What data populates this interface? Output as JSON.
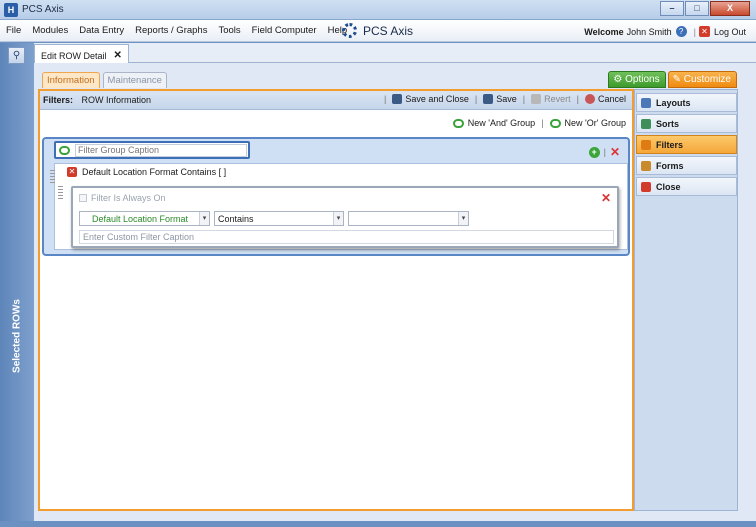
{
  "window": {
    "title": "PCS Axis",
    "controls": [
      "–",
      "□",
      "X"
    ]
  },
  "menubar": {
    "items": [
      "File",
      "Modules",
      "Data Entry",
      "Reports / Graphs",
      "Tools",
      "Field Computer",
      "Help"
    ],
    "brand": "PCS Axis",
    "welcome": "Welcome",
    "user": "John Smith",
    "logout": "Log Out"
  },
  "sidebar": {
    "selected_label": "Selected ROWs"
  },
  "doc_tab": {
    "label": "Edit ROW Detail",
    "close": "✕"
  },
  "subtabs": {
    "information": "Information",
    "maintenance": "Maintenance"
  },
  "top_buttons": {
    "options": "Options",
    "customize": "Customize"
  },
  "filter_bar": {
    "label": "Filters:",
    "value": "ROW Information",
    "save_close": "Save and Close",
    "save": "Save",
    "revert": "Revert",
    "cancel": "Cancel"
  },
  "group_actions": {
    "new_and": "New 'And' Group",
    "new_or": "New 'Or' Group"
  },
  "filter_group": {
    "caption_placeholder": "Filter Group Caption",
    "condition_summary": "Default Location Format Contains [          ]",
    "editor": {
      "always_on": "Filter Is Always On",
      "field": "Default Location Format",
      "operator": "Contains",
      "value": "",
      "custom_caption_placeholder": "Enter Custom Filter Caption"
    }
  },
  "right_panel": {
    "items": [
      {
        "label": "Layouts",
        "icon": "layouts-icon",
        "active": false
      },
      {
        "label": "Sorts",
        "icon": "sorts-icon",
        "active": false
      },
      {
        "label": "Filters",
        "icon": "filter-icon",
        "active": true
      },
      {
        "label": "Forms",
        "icon": "forms-icon",
        "active": false
      },
      {
        "label": "Close",
        "icon": "close-icon",
        "active": false
      }
    ]
  },
  "colors": {
    "accent_orange": "#f59c2e",
    "accent_green": "#3d9a2b",
    "accent_blue": "#3c6fb7"
  }
}
